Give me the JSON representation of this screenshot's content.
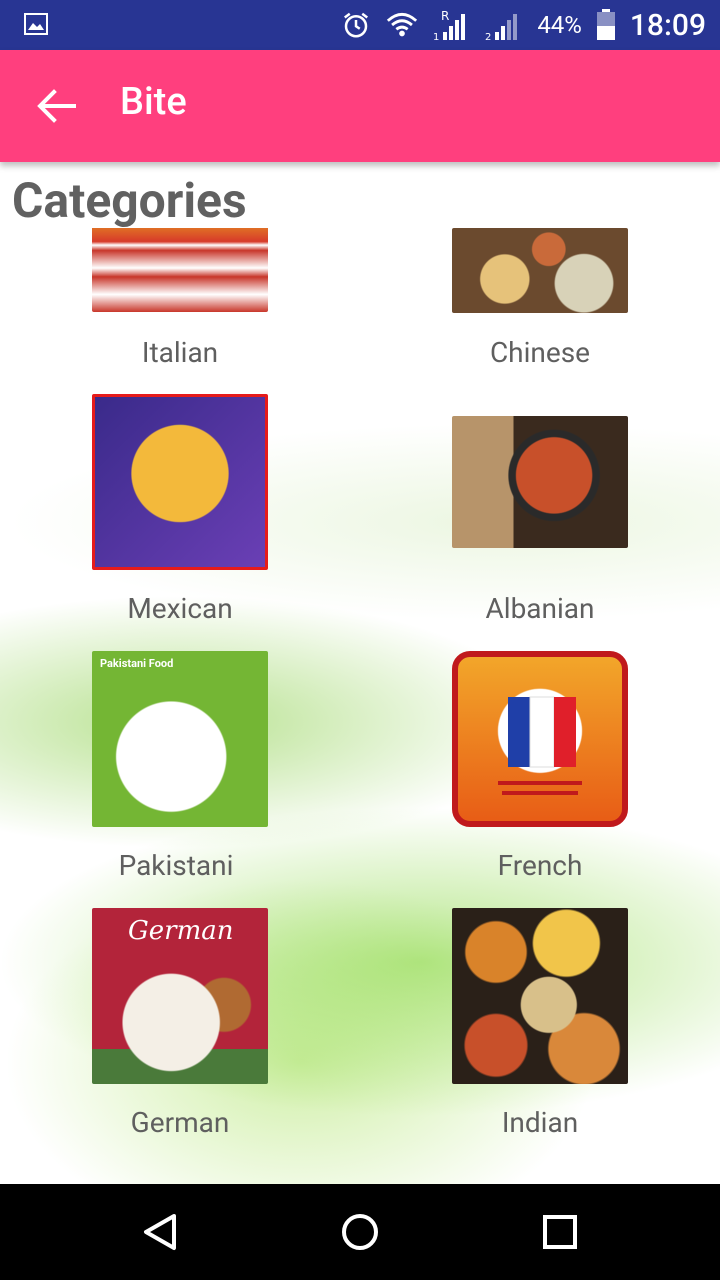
{
  "status_bar": {
    "battery_percent": "44%",
    "time": "18:09",
    "icons": [
      "gallery-icon",
      "alarm-icon",
      "wifi-icon",
      "signal-icon",
      "signal-icon",
      "battery-icon"
    ],
    "color": "#283593"
  },
  "app_bar": {
    "title": "Bite",
    "color": "#ff3f7e"
  },
  "main": {
    "heading": "Categories",
    "categories": [
      {
        "label": "Italian"
      },
      {
        "label": "Chinese"
      },
      {
        "label": "Mexican"
      },
      {
        "label": "Albanian"
      },
      {
        "label": "Pakistani",
        "image_text": "Pakistani Food"
      },
      {
        "label": "French"
      },
      {
        "label": "German",
        "image_text": "German"
      },
      {
        "label": "Indian"
      }
    ]
  },
  "nav_bar": {
    "buttons": [
      "back-icon",
      "home-icon",
      "recents-icon"
    ]
  }
}
